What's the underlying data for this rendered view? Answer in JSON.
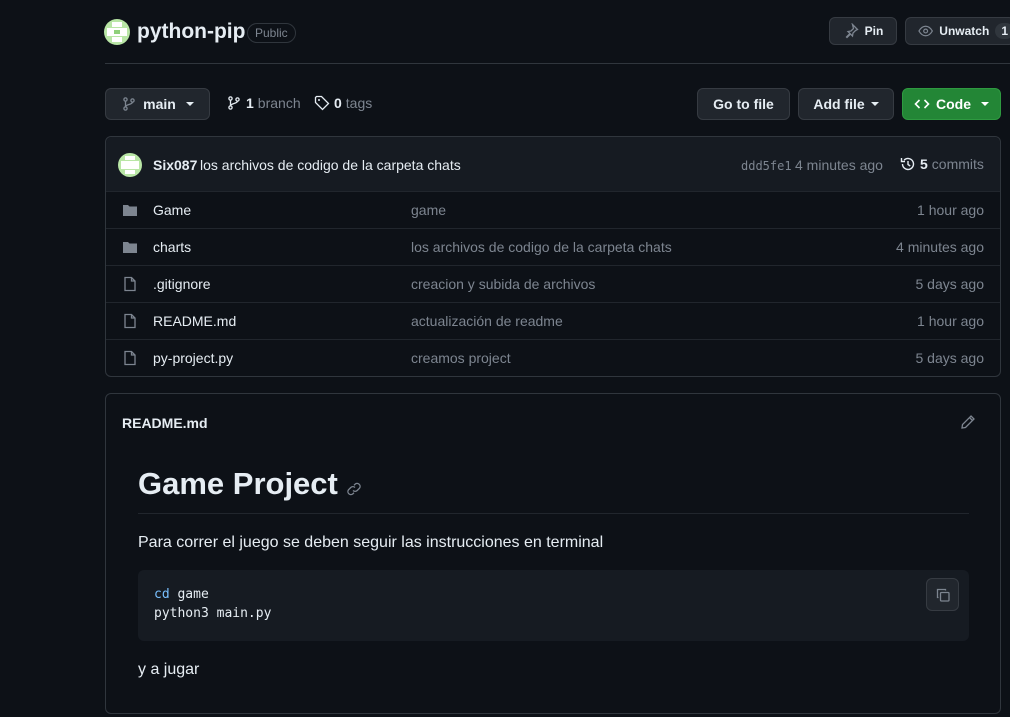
{
  "repo": {
    "name": "python-pip",
    "visibility": "Public"
  },
  "header_actions": {
    "pin_label": "Pin",
    "unwatch_label": "Unwatch",
    "watch_count": "1"
  },
  "toolbar": {
    "branch_name": "main",
    "branch_count": "1",
    "branch_label": "branch",
    "tag_count": "0",
    "tag_label": "tags",
    "go_to_file_label": "Go to file",
    "add_file_label": "Add file",
    "code_label": "Code"
  },
  "latest_commit": {
    "author": "Six087",
    "message": "los archivos de codigo de la carpeta chats",
    "hash": "ddd5fe1",
    "time": "4 minutes ago",
    "commit_count": "5",
    "commits_label": "commits"
  },
  "files": [
    {
      "type": "folder",
      "name": "Game",
      "message": "game",
      "age": "1 hour ago"
    },
    {
      "type": "folder",
      "name": "charts",
      "message": "los archivos de codigo de la carpeta chats",
      "age": "4 minutes ago"
    },
    {
      "type": "file",
      "name": ".gitignore",
      "message": "creacion y subida de archivos",
      "age": "5 days ago"
    },
    {
      "type": "file",
      "name": "README.md",
      "message": "actualización de readme",
      "age": "1 hour ago"
    },
    {
      "type": "file",
      "name": "py-project.py",
      "message": "creamos project",
      "age": "5 days ago"
    }
  ],
  "readme": {
    "filename": "README.md",
    "heading": "Game Project",
    "paragraph": "Para correr el juego se deben seguir las instrucciones en terminal",
    "code_line1_cmd": "cd",
    "code_line1_arg": "game",
    "code_line2": "python3 main.py",
    "footer": "y a jugar"
  },
  "colors": {
    "background": "#0d1117",
    "green_button": "#238636",
    "border": "#30363d",
    "muted": "#7d8590"
  }
}
